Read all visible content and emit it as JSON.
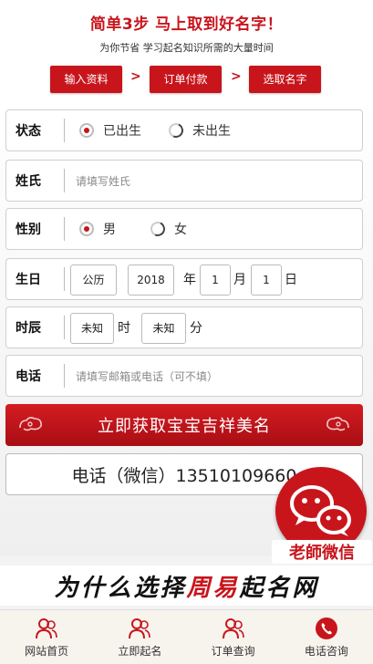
{
  "header": {
    "title": "简单3步 马上取到好名字！",
    "subtitle": "为你节省 学习起名知识所需的大量时间",
    "steps": [
      "输入资料",
      "订单付款",
      "选取名字"
    ],
    "arrow": ">"
  },
  "form": {
    "status": {
      "label": "状态",
      "options": [
        {
          "label": "已出生",
          "selected": true
        },
        {
          "label": "未出生",
          "selected": false
        }
      ]
    },
    "surname": {
      "label": "姓氏",
      "placeholder": "请填写姓氏"
    },
    "gender": {
      "label": "性别",
      "options": [
        {
          "label": "男",
          "selected": true
        },
        {
          "label": "女",
          "selected": false
        }
      ]
    },
    "birthday": {
      "label": "生日",
      "calendar": "公历",
      "year": "2018",
      "year_unit": "年",
      "month": "1",
      "month_unit": "月",
      "day": "1",
      "day_unit": "日"
    },
    "hour": {
      "label": "时辰",
      "hour_value": "未知",
      "hour_unit": "时",
      "minute_value": "未知",
      "minute_unit": "分"
    },
    "contact": {
      "label": "电话",
      "placeholder": "请填写邮箱或电话（可不填）"
    },
    "submit_label": "立即获取宝宝吉祥美名",
    "phone_line": "电话（微信）13510109660"
  },
  "floating": {
    "wechat_label": "老師微信",
    "icon": "wechat-icon"
  },
  "banner": {
    "part1": "为什么选择",
    "part2": "周易",
    "part3": "起名网"
  },
  "bottom_nav": [
    {
      "label": "网站首页",
      "icon": "users-icon"
    },
    {
      "label": "立即起名",
      "icon": "users-icon"
    },
    {
      "label": "订单查询",
      "icon": "users-icon"
    },
    {
      "label": "电话咨询",
      "icon": "phone-icon"
    }
  ],
  "colors": {
    "accent": "#c8151c",
    "background": "#f3f3f3"
  }
}
